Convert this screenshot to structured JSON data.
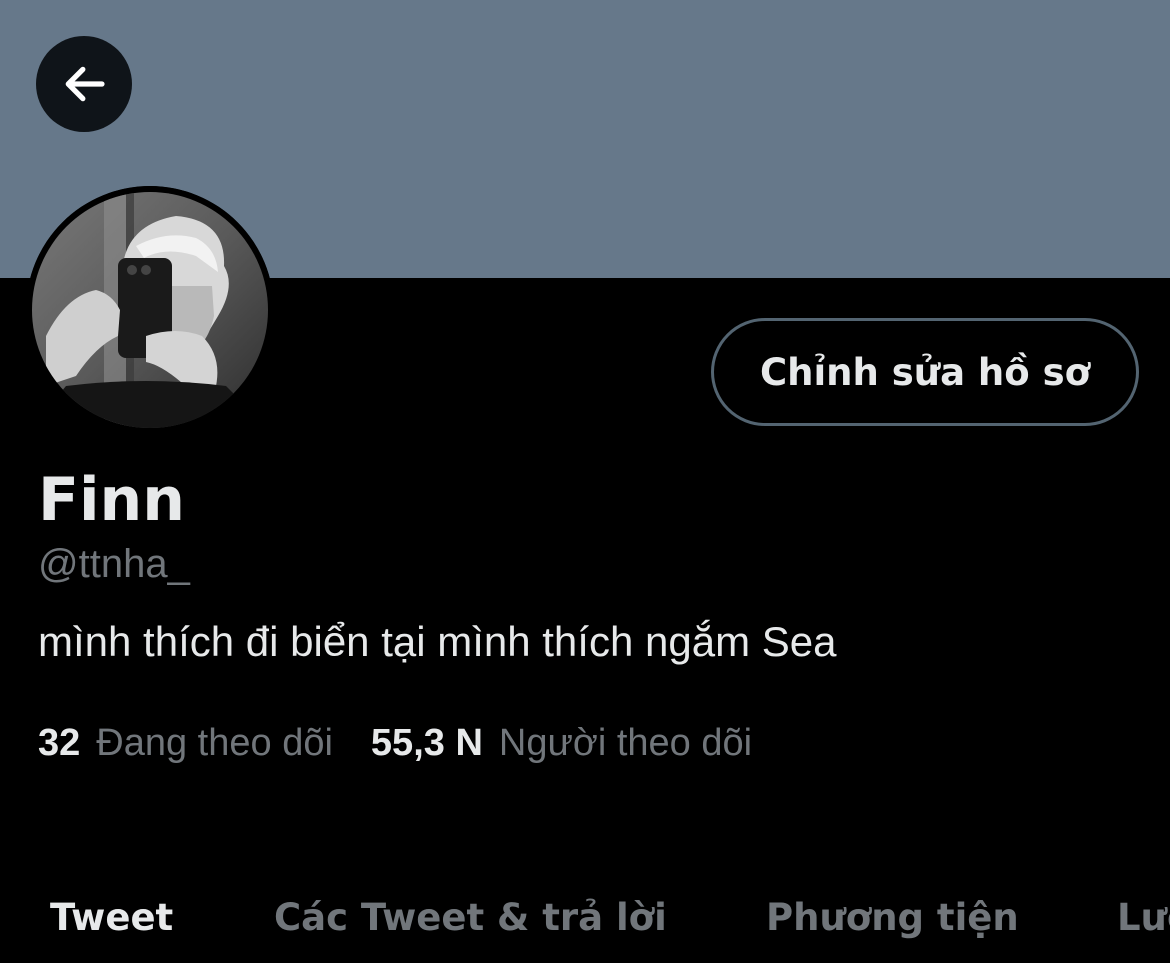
{
  "header": {
    "back_icon": "arrow-left-icon",
    "banner_color": "#66788a"
  },
  "profile": {
    "avatar_icon": "profile-photo-avatar",
    "edit_button_label": "Chỉnh sửa hồ sơ",
    "display_name": "Finn",
    "handle": "@ttnha_",
    "bio": "mình thích đi biển tại mình thích ngắm Sea",
    "following_count": "32",
    "following_label": "Đang theo dõi",
    "followers_count": "55,3 N",
    "followers_label": "Người theo dõi"
  },
  "tabs": [
    {
      "label": "Tweet",
      "active": true
    },
    {
      "label": "Các Tweet & trả lời",
      "active": false
    },
    {
      "label": "Phương tiện",
      "active": false
    },
    {
      "label": "Lượt thích",
      "active": false
    }
  ],
  "colors": {
    "background": "#000000",
    "primary_text": "#e7e9ea",
    "secondary_text": "#71767b",
    "border": "#536471"
  }
}
